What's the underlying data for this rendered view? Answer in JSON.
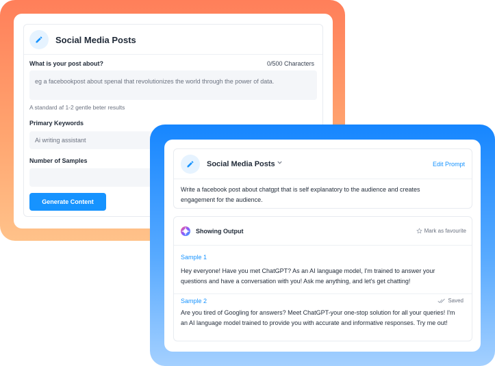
{
  "back_form": {
    "title": "Social Media Posts",
    "post_label": "What is your post about?",
    "char_counter": "0/500 Characters",
    "post_placeholder": "eg a facebookpost about spenal that revolutionizes the world through the power of data.",
    "hint": "A standard af 1-2 gentle beter results",
    "keywords_label": "Primary Keywords",
    "keywords_placeholder": "Ai writing assistant",
    "samples_label": "Number of Samples",
    "samples_value": "",
    "generate_button": "Generate Content"
  },
  "front_output": {
    "title": "Social Media Posts",
    "edit_prompt": "Edit Prompt",
    "prompt_text": "Write a facebook post about chatgpt that is self explanatory to the audience and creates engagement for the audience.",
    "output_title": "Showing Output",
    "mark_favourite": "Mark as favourite",
    "samples": [
      {
        "label": "Sample 1",
        "text": "Hey everyone! Have you met ChatGPT? As an AI language model, I'm trained to answer your questions and have a conversation with you! Ask me anything, and let's get chatting!"
      },
      {
        "label": "Sample 2",
        "status": "Saved",
        "text": "Are you tired of Googling for answers? Meet ChatGPT-your one-stop solution for all your queries! I'm an AI language model trained to provide you with accurate and informative responses. Try me out!"
      }
    ]
  },
  "colors": {
    "accent": "#1693ff",
    "orange_frame_top": "#ff7f5a",
    "orange_frame_bottom": "#ffc28a",
    "blue_frame_top": "#1686ff",
    "blue_frame_bottom": "#a4d0ff"
  },
  "icons": {
    "pen": "pencil-icon",
    "chevron": "chevron-down-icon",
    "star": "star-icon",
    "check": "check-icon",
    "logo": "app-logo-icon"
  }
}
